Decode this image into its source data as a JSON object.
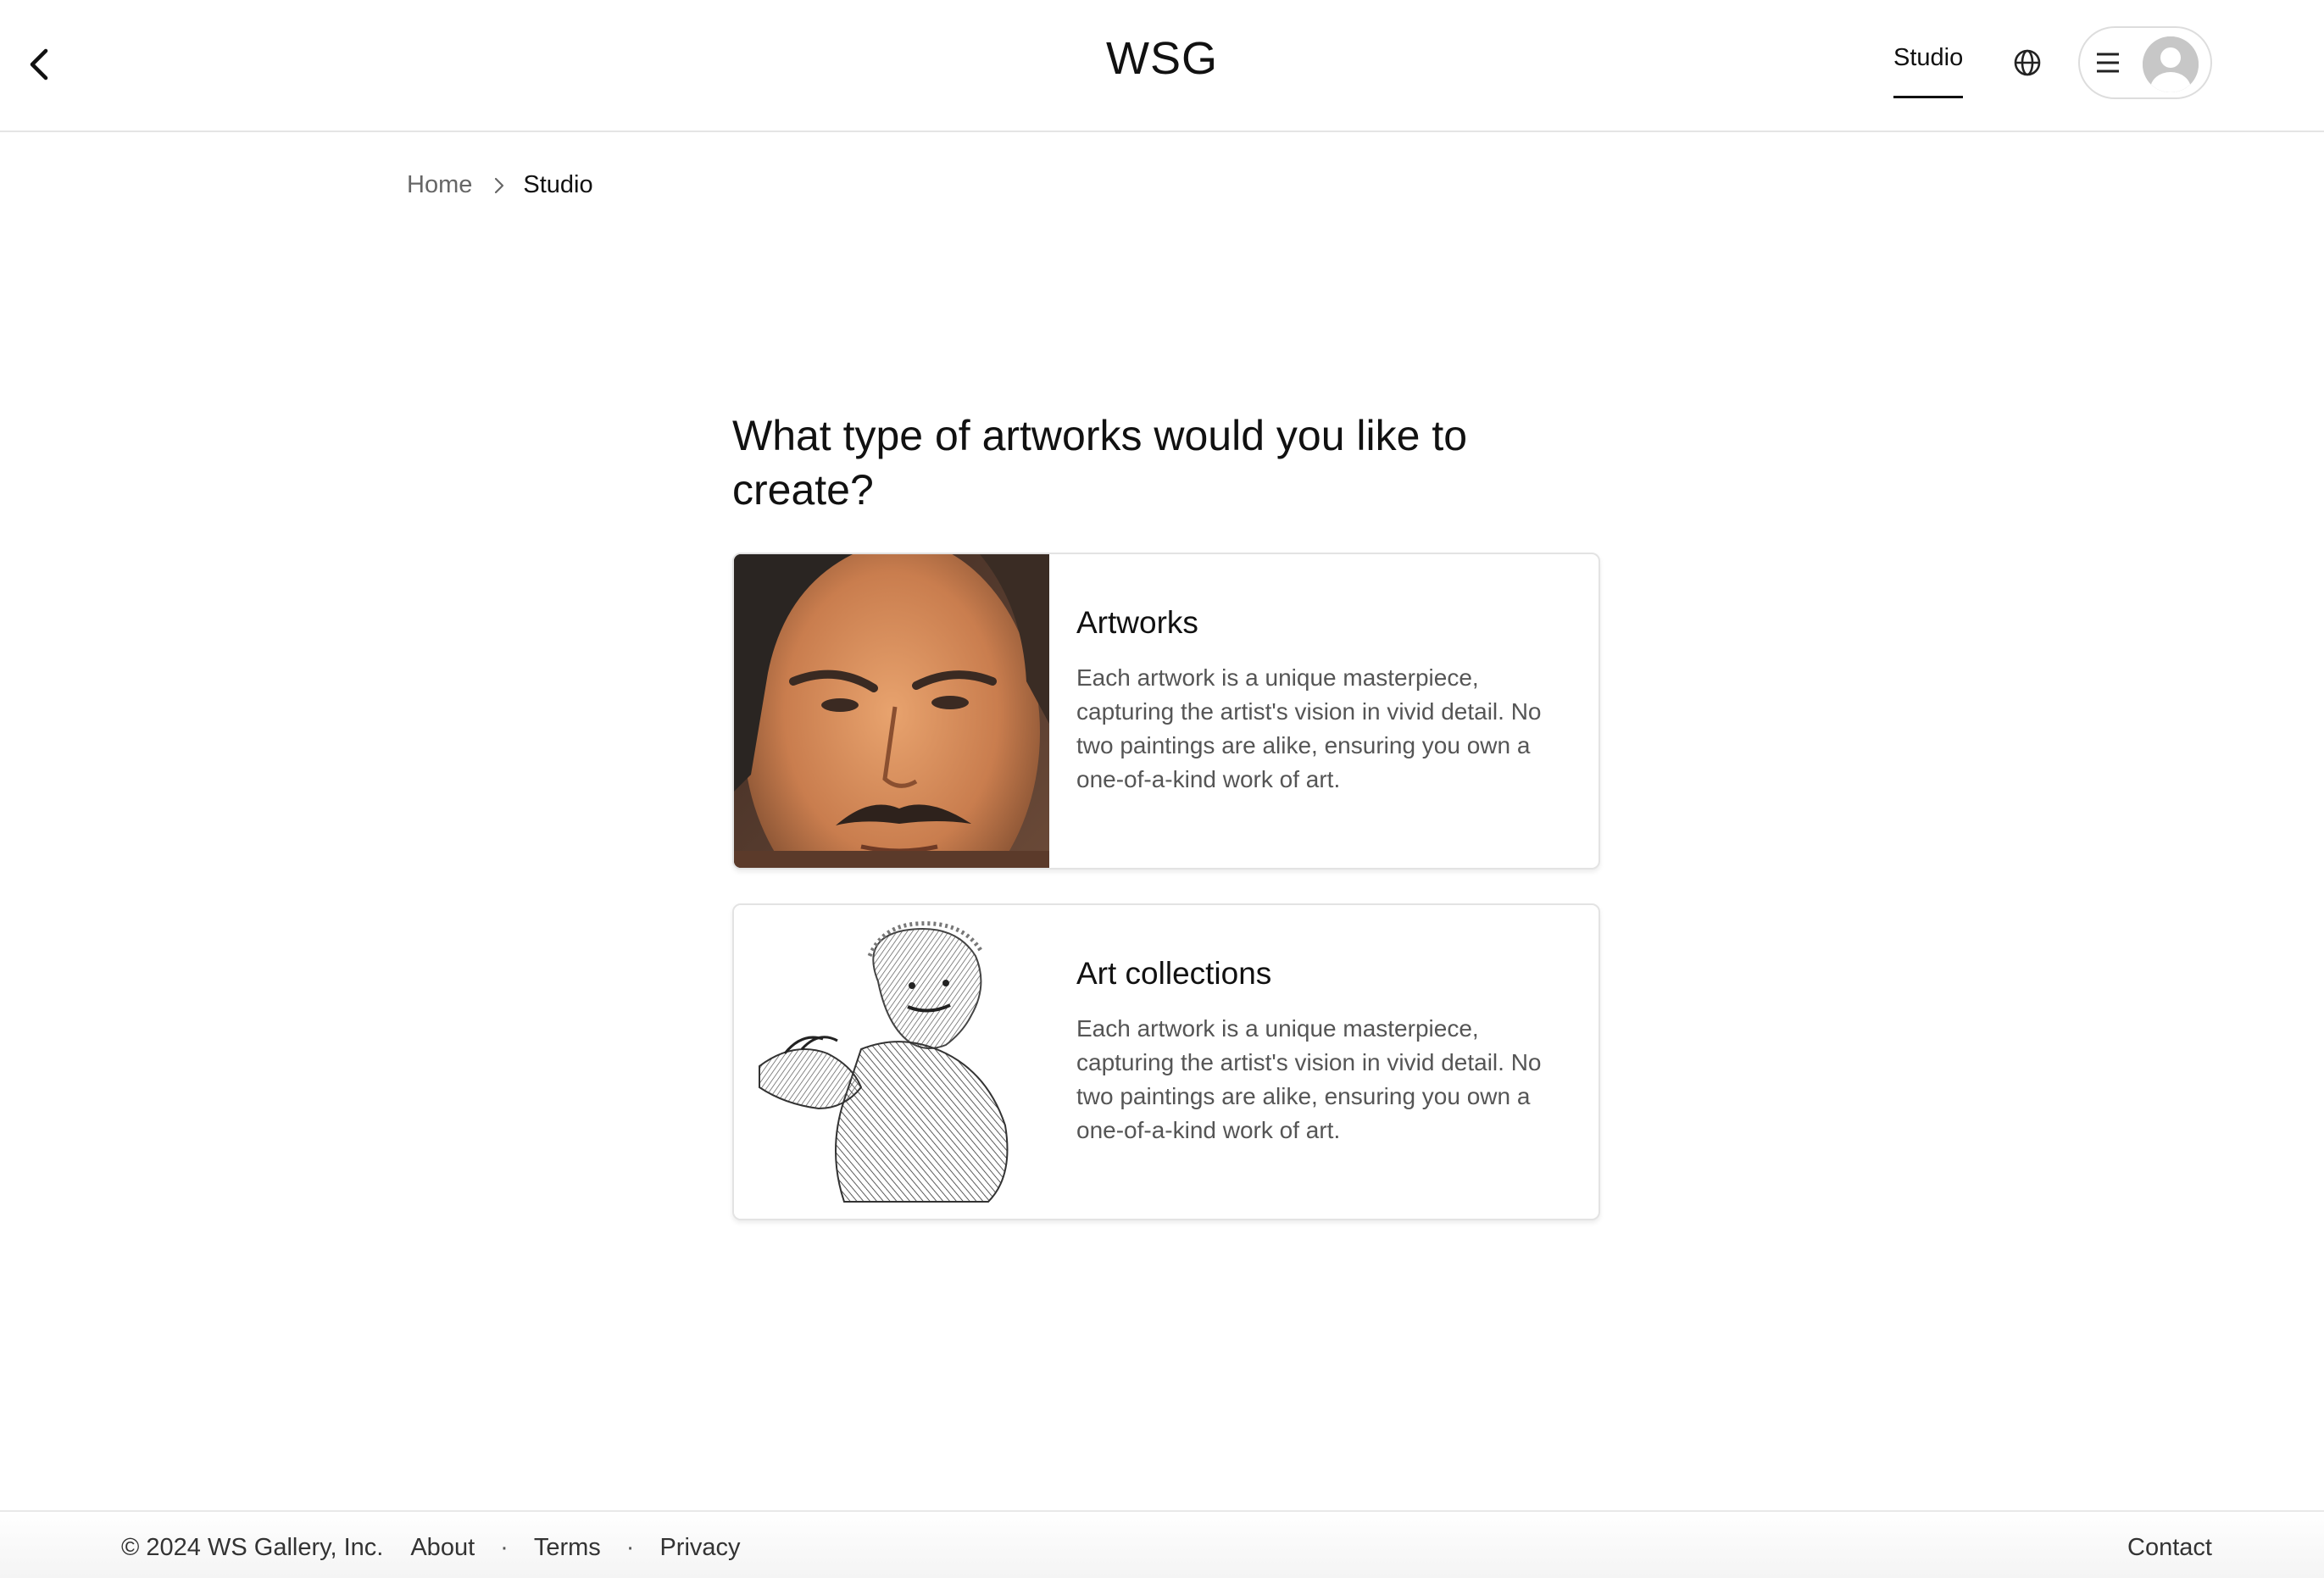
{
  "header": {
    "logo": "WSG",
    "nav_studio": "Studio",
    "icons": {
      "back": "chevron-left-icon",
      "globe": "globe-icon",
      "menu": "hamburger-menu-icon",
      "avatar": "user-avatar-icon"
    }
  },
  "breadcrumb": {
    "home": "Home",
    "current": "Studio"
  },
  "main": {
    "question": "What type of artworks would you like to create?",
    "cards": [
      {
        "title": "Artworks",
        "description": "Each artwork is a unique masterpiece, capturing the artist's vision in vivid detail. No two paintings are alike, ensuring you own a one-of-a-kind work of art."
      },
      {
        "title": "Art collections",
        "description": "Each artwork is a unique masterpiece, capturing the artist's vision in vivid detail. No two paintings are alike, ensuring you own a one-of-a-kind work of art."
      }
    ]
  },
  "footer": {
    "copyright": "© 2024 WS Gallery, Inc.",
    "about": "About",
    "separator": "·",
    "terms": "Terms",
    "privacy": "Privacy",
    "contact": "Contact"
  },
  "colors": {
    "text_primary": "#111111",
    "text_secondary": "#555555",
    "border": "#e3e3e3"
  }
}
